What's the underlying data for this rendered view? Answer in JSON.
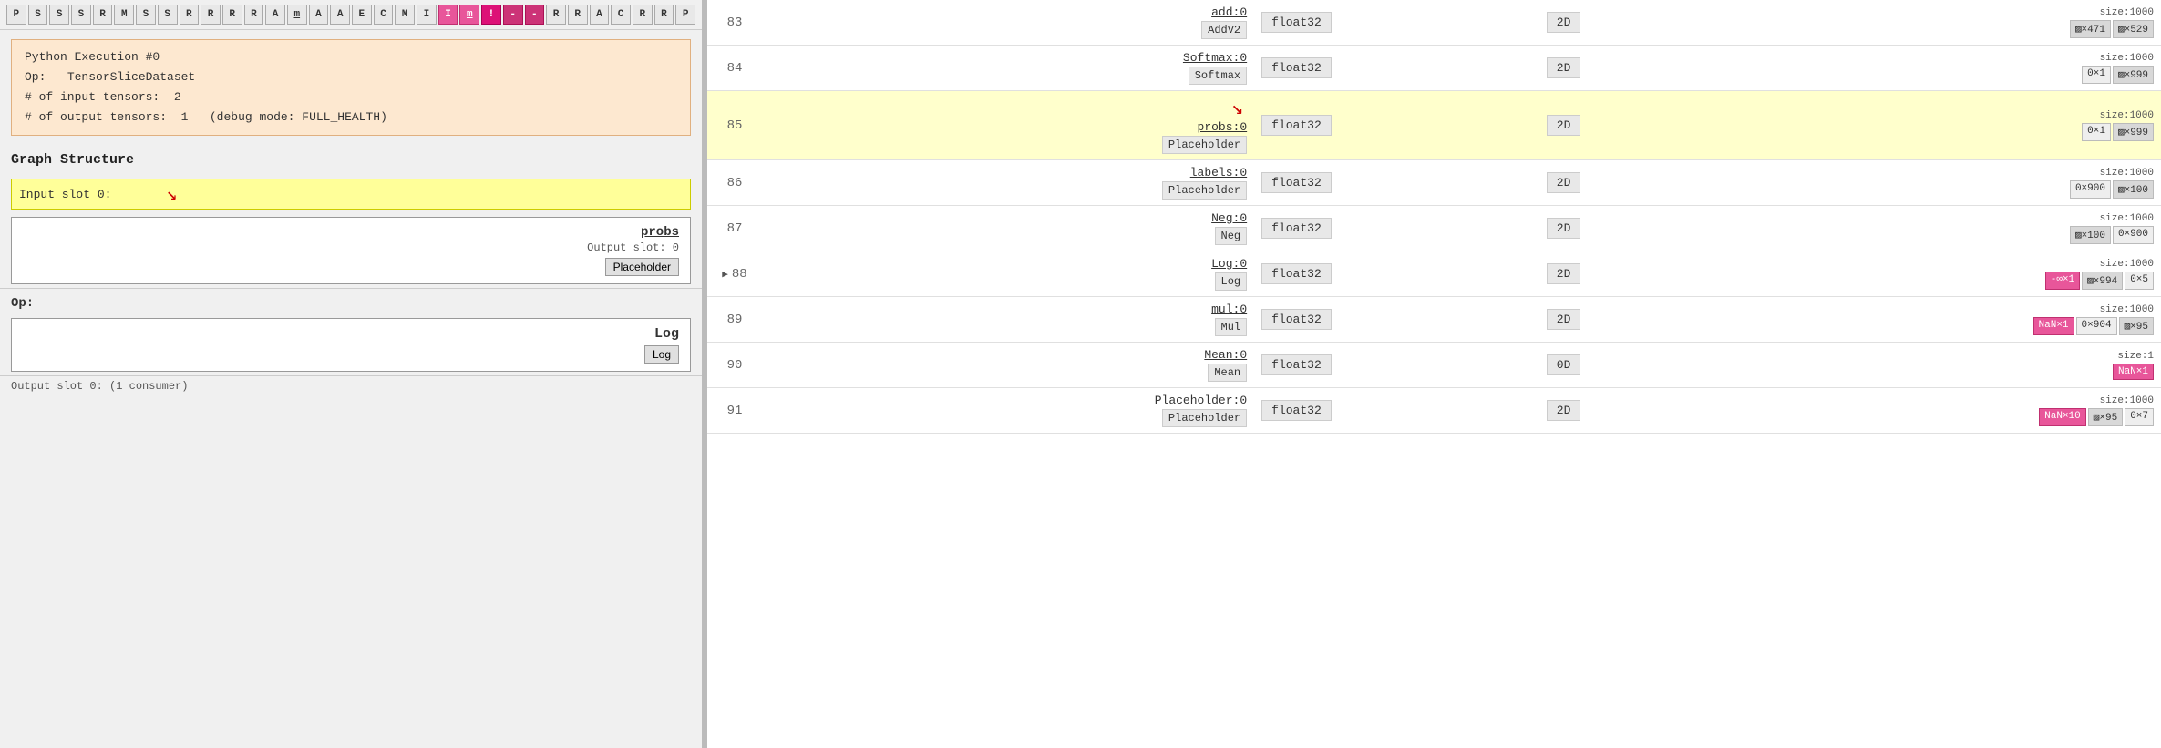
{
  "topbar": {
    "cells": [
      "P",
      "S",
      "S",
      "S",
      "R",
      "M",
      "S",
      "S",
      "R",
      "R",
      "R",
      "R",
      "A",
      "m",
      "A",
      "A",
      "E",
      "C",
      "M",
      "I",
      "I",
      "m",
      "!",
      "-",
      "-",
      "R",
      "R",
      "A",
      "C",
      "R",
      "R",
      "P"
    ]
  },
  "infobox": {
    "title": "Python Execution #0",
    "op_label": "Op:",
    "op_value": "TensorSliceDataset",
    "input_label": "# of input tensors:",
    "input_value": "2",
    "output_label": "# of output tensors:",
    "output_value": "1",
    "debug_label": "(debug mode: FULL_HEALTH)"
  },
  "graphStructure": {
    "title": "Graph Structure",
    "inputSlotLabel": "Input slot 0:",
    "probs_link": "probs",
    "outputSlot": "Output slot: 0",
    "placeholderBtn": "Placeholder",
    "opLabel": "Op:",
    "opName": "Log",
    "logBtn": "Log",
    "outputSlotBottom": "Output slot 0: (1 consumer)"
  },
  "table": {
    "rows": [
      {
        "num": "83",
        "op_name": "add:0",
        "op_type": "AddV2",
        "dtype": "float32",
        "dim": "2D",
        "size_label": "size:1000",
        "size_badges": [
          {
            "label": "▨×471",
            "type": "gray"
          },
          {
            "label": "▨×529",
            "type": "gray"
          }
        ],
        "highlighted": false,
        "expanded": false,
        "has_arrow": false
      },
      {
        "num": "84",
        "op_name": "Softmax:0",
        "op_type": "Softmax",
        "dtype": "float32",
        "dim": "2D",
        "size_label": "size:1000",
        "size_badges": [
          {
            "label": "0×1",
            "type": "light"
          },
          {
            "label": "▨×999",
            "type": "gray"
          }
        ],
        "highlighted": false,
        "expanded": false,
        "has_arrow": false
      },
      {
        "num": "85",
        "op_name": "probs:0",
        "op_type": "Placeholder",
        "dtype": "float32",
        "dim": "2D",
        "size_label": "size:1000",
        "size_badges": [
          {
            "label": "0×1",
            "type": "light"
          },
          {
            "label": "▨×999",
            "type": "gray"
          }
        ],
        "highlighted": true,
        "expanded": false,
        "has_arrow": true
      },
      {
        "num": "86",
        "op_name": "labels:0",
        "op_type": "Placeholder",
        "dtype": "float32",
        "dim": "2D",
        "size_label": "size:1000",
        "size_badges": [
          {
            "label": "0×900",
            "type": "light"
          },
          {
            "label": "▨×100",
            "type": "gray"
          }
        ],
        "highlighted": false,
        "expanded": false,
        "has_arrow": false
      },
      {
        "num": "87",
        "op_name": "Neg:0",
        "op_type": "Neg",
        "dtype": "float32",
        "dim": "2D",
        "size_label": "size:1000",
        "size_badges": [
          {
            "label": "▨×100",
            "type": "gray"
          },
          {
            "label": "0×900",
            "type": "light"
          }
        ],
        "highlighted": false,
        "expanded": false,
        "has_arrow": false
      },
      {
        "num": "88",
        "op_name": "Log:0",
        "op_type": "Log",
        "dtype": "float32",
        "dim": "2D",
        "size_label": "size:1000",
        "size_badges": [
          {
            "label": "-∞×1",
            "type": "pink"
          },
          {
            "label": "▨×994",
            "type": "gray"
          },
          {
            "label": "0×5",
            "type": "light"
          }
        ],
        "highlighted": false,
        "expanded": true,
        "has_arrow": false
      },
      {
        "num": "89",
        "op_name": "mul:0",
        "op_type": "Mul",
        "dtype": "float32",
        "dim": "2D",
        "size_label": "size:1000",
        "size_badges": [
          {
            "label": "NaN×1",
            "type": "nan"
          },
          {
            "label": "0×904",
            "type": "light"
          },
          {
            "label": "▨×95",
            "type": "gray"
          }
        ],
        "highlighted": false,
        "expanded": false,
        "has_arrow": false
      },
      {
        "num": "90",
        "op_name": "Mean:0",
        "op_type": "Mean",
        "dtype": "float32",
        "dim": "0D",
        "size_label": "size:1",
        "size_badges": [
          {
            "label": "NaN×1",
            "type": "nan"
          }
        ],
        "highlighted": false,
        "expanded": false,
        "has_arrow": false
      },
      {
        "num": "91",
        "op_name": "Placeholder:0",
        "op_type": "Placeholder",
        "dtype": "float32",
        "dim": "2D",
        "size_label": "size:1000",
        "size_badges": [
          {
            "label": "NaN×10",
            "type": "nan"
          },
          {
            "label": "▨×95",
            "type": "gray"
          },
          {
            "label": "0×7",
            "type": "light"
          }
        ],
        "highlighted": false,
        "expanded": false,
        "has_arrow": false
      }
    ]
  }
}
